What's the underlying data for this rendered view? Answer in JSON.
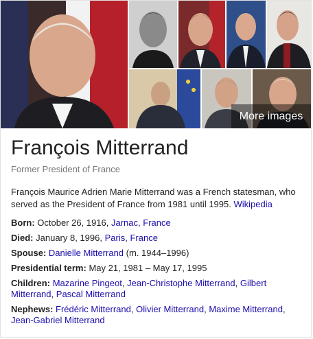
{
  "colors": {
    "link": "#1a0dab",
    "text": "#222222",
    "muted": "#777777",
    "overlay": "rgba(0,0,0,0.45)"
  },
  "images": {
    "more_label": "More images"
  },
  "title": "François Mitterrand",
  "subtitle": "Former President of France",
  "description": {
    "text": "François Maurice Adrien Marie Mitterrand was a French statesman, who served as the President of France from 1981 until 1995.",
    "source_link": "Wikipedia"
  },
  "facts": {
    "born": {
      "label": "Born:",
      "text": "October 26, 1916,",
      "links": [
        "Jarnac",
        "France"
      ]
    },
    "died": {
      "label": "Died:",
      "text": "January 8, 1996,",
      "links": [
        "Paris",
        "France"
      ]
    },
    "spouse": {
      "label": "Spouse:",
      "link": "Danielle Mitterrand",
      "suffix": "(m. 1944–1996)"
    },
    "term": {
      "label": "Presidential term:",
      "text": "May 21, 1981 – May 17, 1995"
    },
    "children": {
      "label": "Children:",
      "links": [
        "Mazarine Pingeot",
        "Jean-Christophe Mitterrand",
        "Gilbert Mitterrand",
        "Pascal Mitterrand"
      ]
    },
    "nephews": {
      "label": "Nephews:",
      "links": [
        "Frédéric Mitterrand",
        "Olivier Mitterrand",
        "Maxime Mitterrand",
        "Jean-Gabriel Mitterrand"
      ]
    }
  }
}
